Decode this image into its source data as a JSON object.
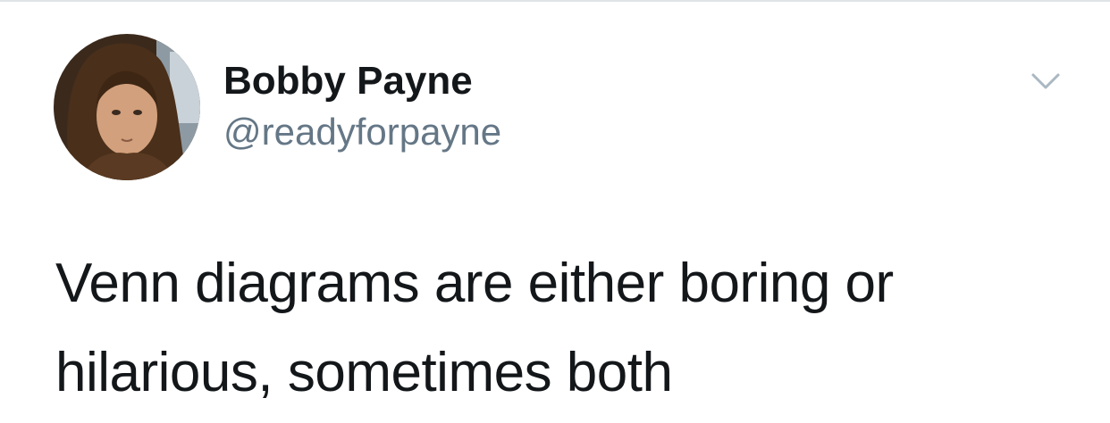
{
  "tweet": {
    "author": {
      "display_name": "Bobby Payne",
      "handle": "@readyforpayne",
      "avatar_icon": "profile-photo"
    },
    "menu_icon": "chevron-down-icon",
    "text": "Venn diagrams are either boring or hilarious, sometimes both"
  },
  "colors": {
    "text_primary": "#14171a",
    "text_secondary": "#657786",
    "divider": "#e1e4e6",
    "chevron": "#aab8c2"
  }
}
